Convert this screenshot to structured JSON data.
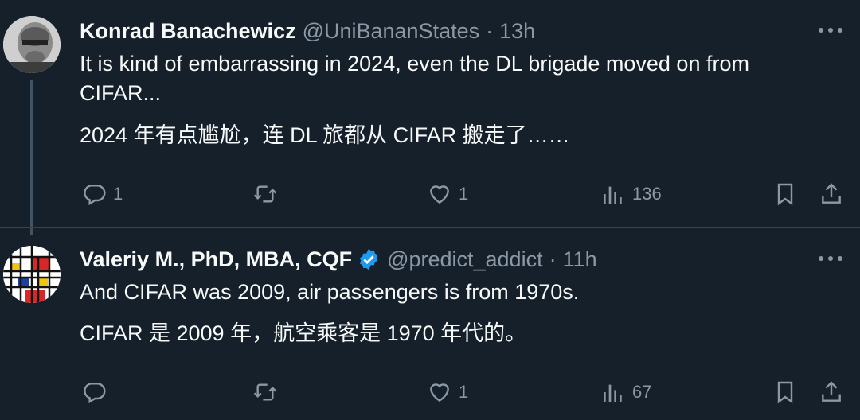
{
  "tweets": [
    {
      "author_name": "Konrad Banachewicz",
      "handle": "@UniBananStates",
      "separator": "·",
      "time": "13h",
      "text_en": "It is kind of embarrassing in 2024, even the DL brigade moved on from CIFAR...",
      "text_zh": "2024 年有点尴尬，连 DL 旅都从 CIFAR 搬走了……",
      "replies": "1",
      "retweets": "",
      "likes": "1",
      "views": "136",
      "avatar_icon": "user-avatar-grayscale-photo",
      "verified": false
    },
    {
      "author_name": "Valeriy M., PhD, MBA, CQF",
      "handle": "@predict_addict",
      "separator": "·",
      "time": "11h",
      "text_en": "And CIFAR was 2009, air passengers is from 1970s.",
      "text_zh": "CIFAR 是 2009 年，航空乘客是 1970 年代的。",
      "replies": "",
      "retweets": "",
      "likes": "1",
      "views": "67",
      "avatar_icon": "mondrian-avatar",
      "verified": true
    }
  ],
  "colors": {
    "background": "#15202b",
    "text": "#f7f9f9",
    "muted": "#8b98a5",
    "verified_badge": "#1d9bf0",
    "divider": "#38444d"
  },
  "icons": [
    "reply-icon",
    "retweet-icon",
    "like-icon",
    "views-icon",
    "bookmark-icon",
    "share-icon",
    "more-icon",
    "verified-icon"
  ]
}
